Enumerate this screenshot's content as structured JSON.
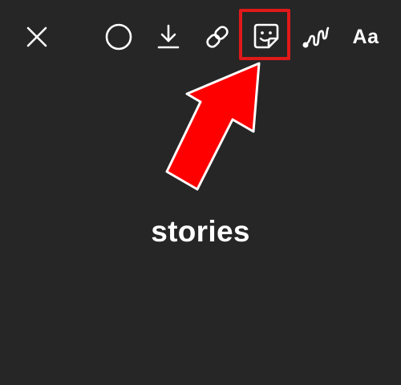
{
  "toolbar": {
    "close": {
      "icon": "close-icon"
    },
    "effects": {
      "icon": "circle-icon"
    },
    "download": {
      "icon": "download-icon"
    },
    "link": {
      "icon": "link-icon"
    },
    "sticker": {
      "icon": "sticker-icon"
    },
    "draw": {
      "icon": "draw-squiggle-icon"
    },
    "text": {
      "label": "Aa"
    }
  },
  "annotation": {
    "highlight_color": "#e0191a",
    "arrow_color": "#ff0000",
    "arrow_outline_color": "#ffffff"
  },
  "canvas": {
    "caption": "stories",
    "background": "#262626"
  }
}
